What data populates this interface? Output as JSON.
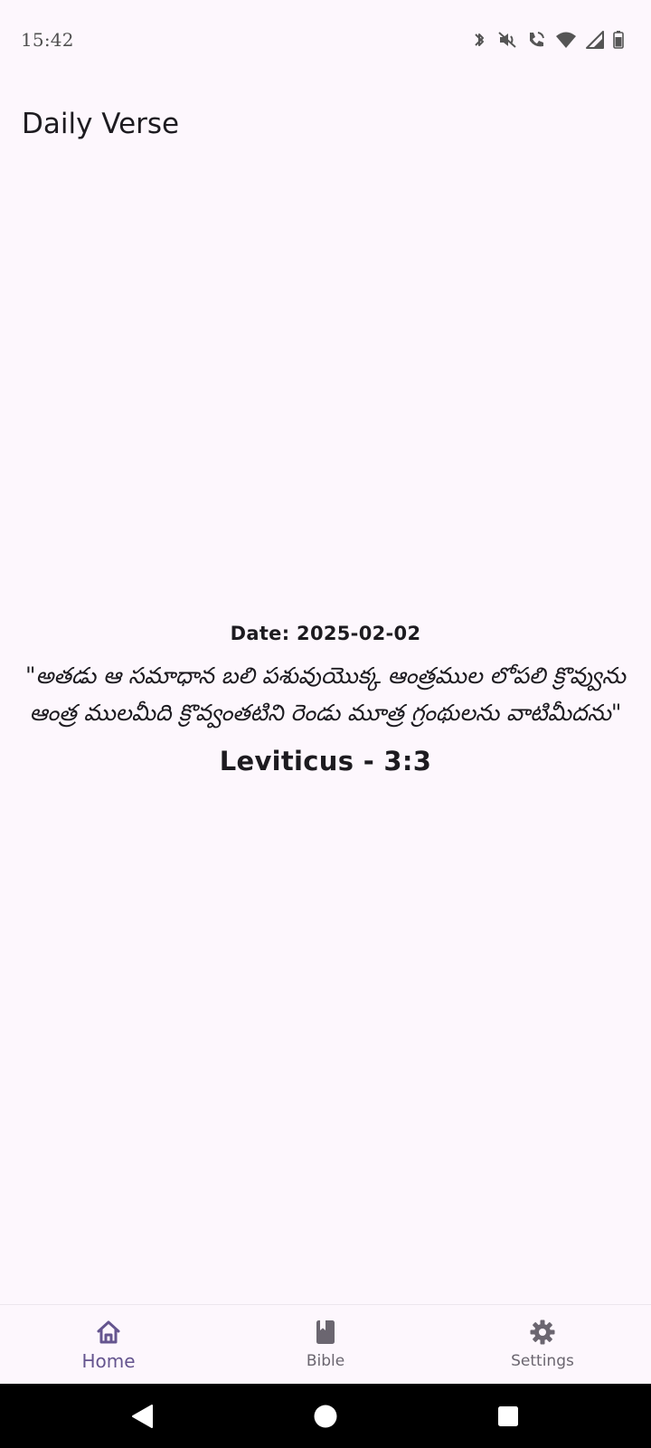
{
  "status_bar": {
    "time": "15:42",
    "icons": [
      "bluetooth-icon",
      "mute-icon",
      "wifi-calling-icon",
      "wifi-icon",
      "signal-icon",
      "battery-icon"
    ]
  },
  "app_bar": {
    "title": "Daily Verse"
  },
  "verse": {
    "date": "Date: 2025-02-02",
    "text": "\"అతడు ఆ సమాధాన బలి పశువుయొక్క ఆంత్రముల లోపలి క్రొవ్వును ఆంత్ర ములమీది క్రొవ్వంతటిని రెండు మూత్ర గ్రంథులను వాటిమీదను\"",
    "reference": "Leviticus - 3:3"
  },
  "bottom_nav": {
    "items": [
      {
        "label": "Home",
        "icon": "home-icon",
        "active": true
      },
      {
        "label": "Bible",
        "icon": "book-icon",
        "active": false
      },
      {
        "label": "Settings",
        "icon": "gear-icon",
        "active": false
      }
    ]
  },
  "colors": {
    "background": "#fdf7fd",
    "accent": "#65558f",
    "text": "#1d1b20",
    "inactive": "#6b6670"
  }
}
